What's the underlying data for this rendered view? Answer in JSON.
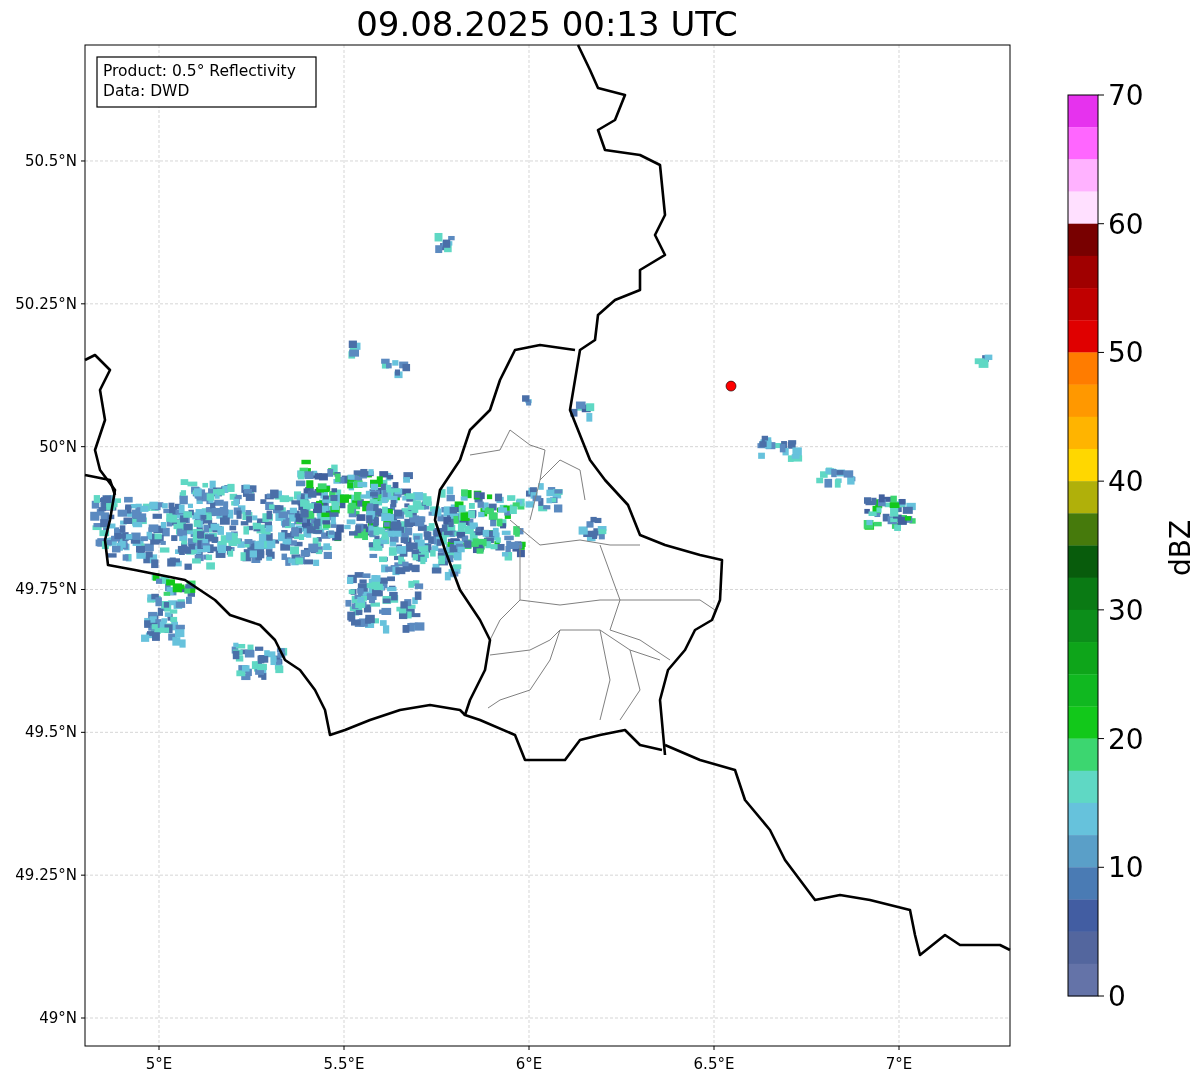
{
  "title": "09.08.2025 00:13 UTC",
  "info_box": [
    "Product: 0.5° Reflectivity",
    "Data: DWD"
  ],
  "map": {
    "chart_data": {
      "type": "scatter",
      "xlim": [
        4.8,
        7.3
      ],
      "ylim": [
        48.951,
        50.703
      ],
      "grid": true,
      "xticks": [
        {
          "value": 5,
          "label": "5°E"
        },
        {
          "value": 5.5,
          "label": "5.5°E"
        },
        {
          "value": 6,
          "label": "6°E"
        },
        {
          "value": 6.5,
          "label": "6.5°E"
        },
        {
          "value": 7,
          "label": "7°E"
        }
      ],
      "yticks": [
        {
          "value": 50.5,
          "label": "50.5°N"
        },
        {
          "value": 50.25,
          "label": "50.25°N"
        },
        {
          "value": 50,
          "label": "50°N"
        },
        {
          "value": 49.75,
          "label": "49.75°N"
        },
        {
          "value": 49.5,
          "label": "49.5°N"
        },
        {
          "value": 49.25,
          "label": "49.25°N"
        },
        {
          "value": 49,
          "label": "49°N"
        }
      ],
      "x": [
        6.546
      ],
      "series": [
        {
          "color": "#ff0000",
          "values": [
            50.106
          ]
        }
      ]
    }
  },
  "colorbar": {
    "label": "dBZ",
    "ticks": [
      "70",
      "60",
      "50",
      "40",
      "30",
      "20",
      "10",
      "0"
    ],
    "segments": [
      {
        "color": "#e632ee"
      },
      {
        "color": "#ff66ff"
      },
      {
        "color": "#ffb2ff"
      },
      {
        "color": "#ffe0ff"
      },
      {
        "color": "#780000"
      },
      {
        "color": "#a00000"
      },
      {
        "color": "#c00000"
      },
      {
        "color": "#e00000"
      },
      {
        "color": "#ff7c00"
      },
      {
        "color": "#ff9800"
      },
      {
        "color": "#ffb400"
      },
      {
        "color": "#ffd700"
      },
      {
        "color": "#b0b00a"
      },
      {
        "color": "#467a0c"
      },
      {
        "color": "#085c0c"
      },
      {
        "color": "#0a7a14"
      },
      {
        "color": "#0c8e1a"
      },
      {
        "color": "#0ea51a"
      },
      {
        "color": "#10b820"
      },
      {
        "color": "#12c81a"
      },
      {
        "color": "#3cd670"
      },
      {
        "color": "#5fd8c4"
      },
      {
        "color": "#66c2dc"
      },
      {
        "color": "#5a9fc8"
      },
      {
        "color": "#4a7bb4"
      },
      {
        "color": "#425da2"
      },
      {
        "color": "#53669e"
      },
      {
        "color": "#6473a8"
      }
    ]
  }
}
